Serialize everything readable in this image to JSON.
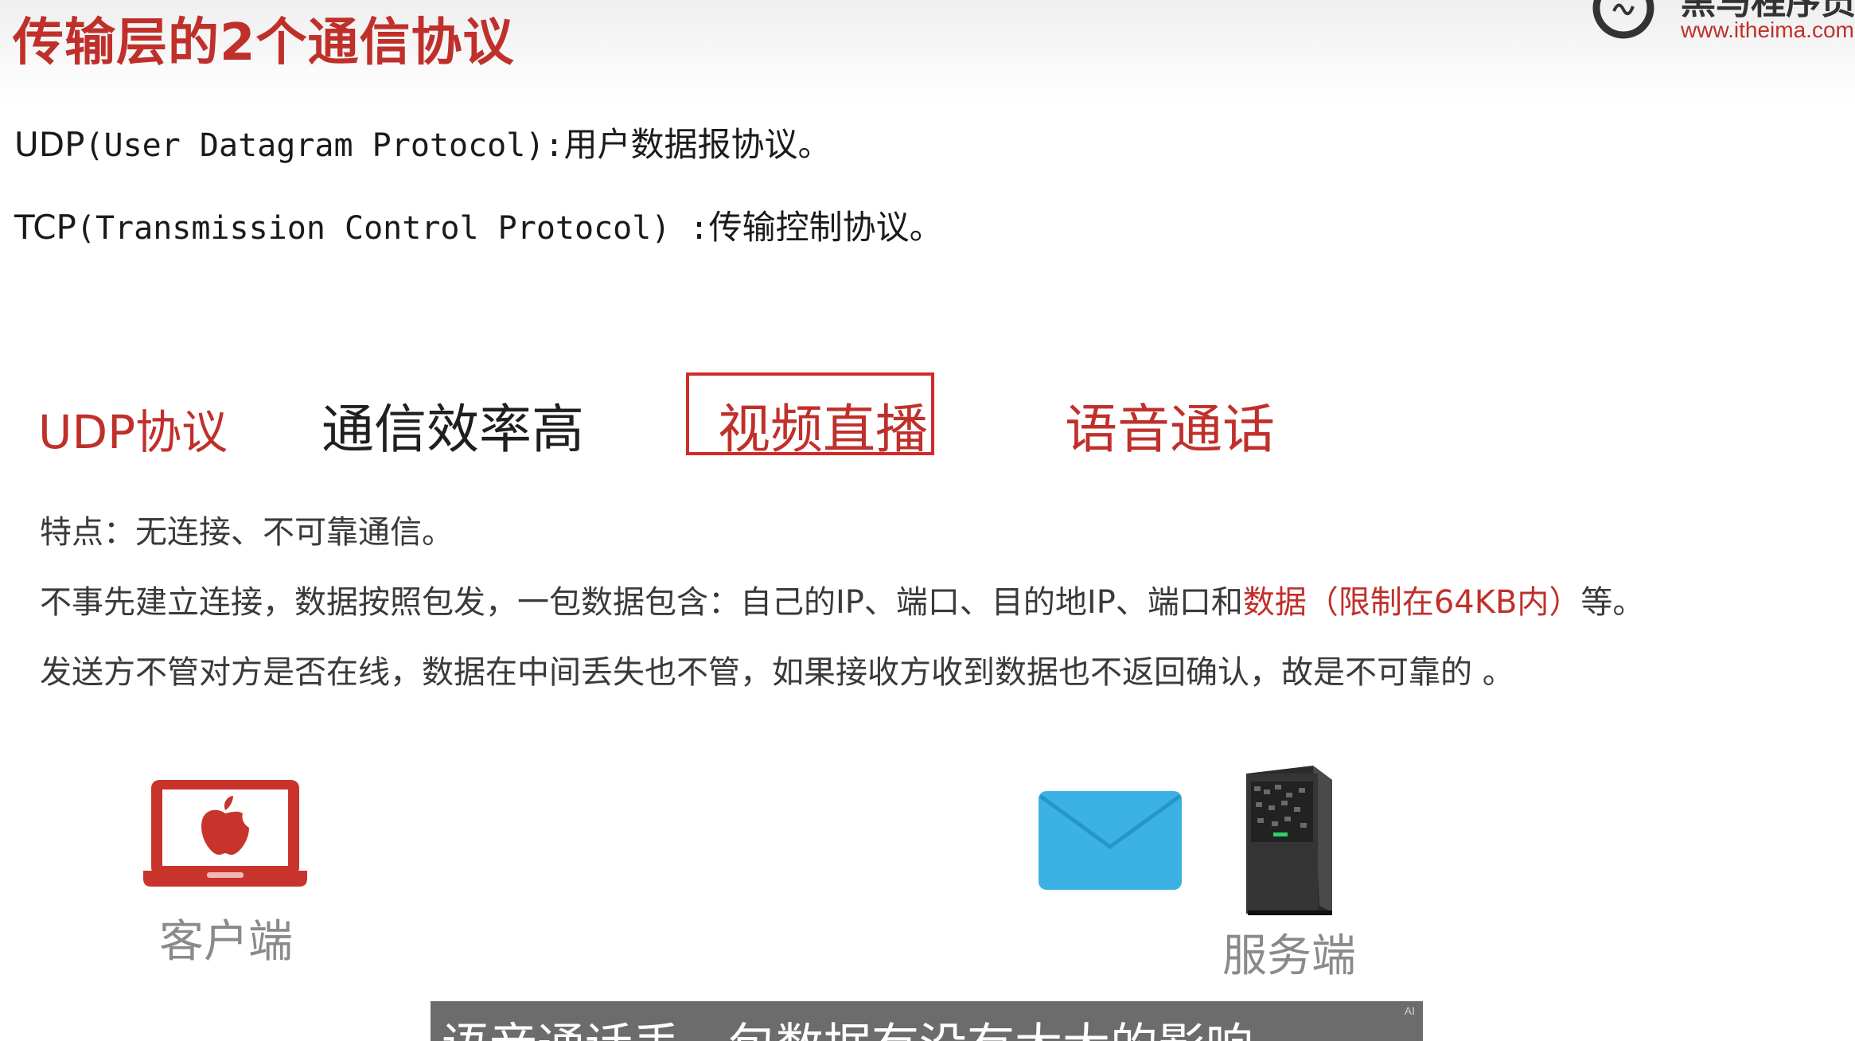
{
  "slide": {
    "title": "传输层的2个通信协议",
    "logo": {
      "name": "黑马程序员",
      "url": "www.itheima.com"
    }
  },
  "protocols": {
    "udp": {
      "abbr": "UDP",
      "full": "(User Datagram Protocol)",
      "sep": ":",
      "desc": "用户数据报协议。"
    },
    "tcp": {
      "abbr": "TCP",
      "full": "(Transmission Control Protocol)",
      "sep": " :",
      "desc": "传输控制协议。"
    }
  },
  "features": {
    "name": "UDP协议",
    "efficiency": "通信效率高",
    "video": "视频直播",
    "voice": "语音通话"
  },
  "details": {
    "line1": "特点：无连接、不可靠通信。",
    "line2_pre": "不事先建立连接，数据按照包发，一包数据包含：自己的IP、端口、目的地IP、端口和",
    "line2_hl": "数据（限制在64KB内）",
    "line2_post": "等。",
    "line3": "发送方不管对方是否在线，数据在中间丢失也不管，如果接收方收到数据也不返回确认，故是不可靠的 。"
  },
  "diagram": {
    "client_label": "客户端",
    "server_label": "服务端"
  },
  "subtitle": {
    "text": "语音通话丢一包数据有没有太大的影响",
    "badge": "AI"
  },
  "colors": {
    "accent": "#c0302b",
    "box_border": "#d22a2a",
    "envelope": "#3bb2e3"
  }
}
